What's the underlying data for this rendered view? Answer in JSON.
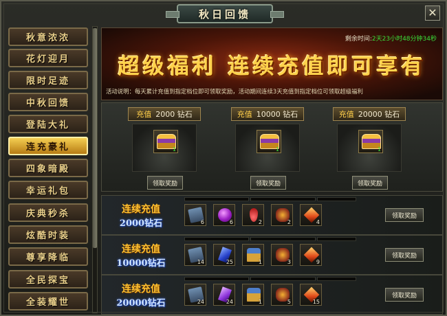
{
  "window": {
    "title": "秋日回馈",
    "close_glyph": "✕"
  },
  "sidebar": {
    "items": [
      {
        "label": "秋意浓浓",
        "active": false
      },
      {
        "label": "花灯迎月",
        "active": false
      },
      {
        "label": "限时足迹",
        "active": false
      },
      {
        "label": "中秋回馈",
        "active": false
      },
      {
        "label": "登陆大礼",
        "active": false
      },
      {
        "label": "连充豪礼",
        "active": true
      },
      {
        "label": "四象暗殿",
        "active": false
      },
      {
        "label": "幸运礼包",
        "active": false
      },
      {
        "label": "庆典秒杀",
        "active": false
      },
      {
        "label": "炫酷时装",
        "active": false
      },
      {
        "label": "尊享降临",
        "active": false
      },
      {
        "label": "全民探宝",
        "active": false
      },
      {
        "label": "全装耀世",
        "active": false
      }
    ]
  },
  "banner": {
    "timer_label": "剩余时间:",
    "timer_value": "2天23小时48分钟34秒",
    "headline": "超级福利 连续充值即可享有",
    "notice": "活动说明：每天累计充值到指定档位即可领取奖励，活动期间连续3天充值到指定档位可领取超级福利"
  },
  "cards": [
    {
      "prefix": "充值",
      "amount": "2000 钻石",
      "count": "1",
      "button": "领取奖励"
    },
    {
      "prefix": "充值",
      "amount": "10000 钻石",
      "count": "1",
      "button": "领取奖励"
    },
    {
      "prefix": "充值",
      "amount": "20000 钻石",
      "count": "1",
      "button": "领取奖励"
    }
  ],
  "rows": [
    {
      "title": "连续充值",
      "amount": "2000钻石",
      "button": "领取奖励",
      "items": [
        {
          "icon": "scroll-icon",
          "count": "6"
        },
        {
          "icon": "orb-icon",
          "count": "6"
        },
        {
          "icon": "blood-drop-icon",
          "count": "2"
        },
        {
          "icon": "dragon-icon",
          "count": "2"
        },
        {
          "icon": "crystal-icon",
          "count": "4"
        }
      ]
    },
    {
      "title": "连续充值",
      "amount": "10000钻石",
      "button": "领取奖励",
      "items": [
        {
          "icon": "scroll-icon",
          "count": "14"
        },
        {
          "icon": "blue-gem-icon",
          "count": "25"
        },
        {
          "icon": "chest-icon",
          "count": "1"
        },
        {
          "icon": "dragon-icon",
          "count": "3"
        },
        {
          "icon": "crystal-icon",
          "count": "9"
        }
      ]
    },
    {
      "title": "连续充值",
      "amount": "20000钻石",
      "button": "领取奖励",
      "items": [
        {
          "icon": "scroll-icon",
          "count": "24"
        },
        {
          "icon": "purple-gem-icon",
          "count": "24"
        },
        {
          "icon": "chest-icon",
          "count": "1"
        },
        {
          "icon": "dragon-icon",
          "count": "5"
        },
        {
          "icon": "crystal-icon",
          "count": "15"
        }
      ]
    }
  ],
  "colors": {
    "accent_gold": "#ffc12f",
    "timer_green": "#38e03a",
    "active_tab": "#f4cf52"
  }
}
